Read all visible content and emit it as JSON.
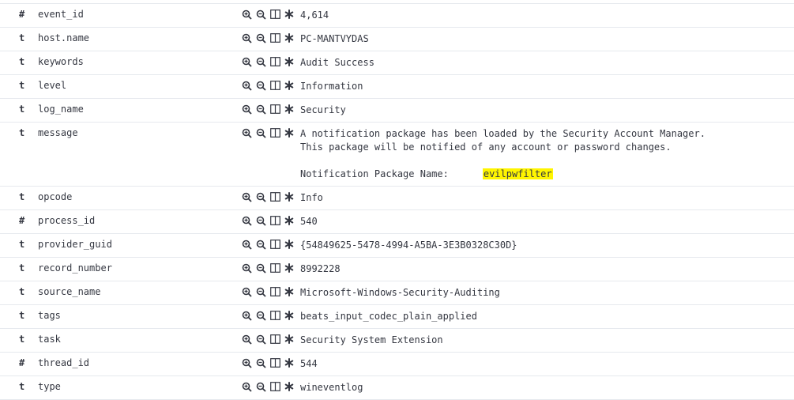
{
  "rows": [
    {
      "type": "#",
      "field": "event_id",
      "value": "4,614"
    },
    {
      "type": "t",
      "field": "host.name",
      "value": "PC-MANTVYDAS"
    },
    {
      "type": "t",
      "field": "keywords",
      "value": "Audit Success"
    },
    {
      "type": "t",
      "field": "level",
      "value": "Information"
    },
    {
      "type": "t",
      "field": "log_name",
      "value": "Security"
    },
    {
      "type": "t",
      "field": "message",
      "value_line1": "A notification package has been loaded by the Security Account Manager.",
      "value_line2": "This package will be notified of any account or password changes.",
      "value_label": "Notification Package Name:",
      "value_highlight": "evilpwfilter"
    },
    {
      "type": "t",
      "field": "opcode",
      "value": "Info"
    },
    {
      "type": "#",
      "field": "process_id",
      "value": "540"
    },
    {
      "type": "t",
      "field": "provider_guid",
      "value": "{54849625-5478-4994-A5BA-3E3B0328C30D}"
    },
    {
      "type": "t",
      "field": "record_number",
      "value": "8992228"
    },
    {
      "type": "t",
      "field": "source_name",
      "value": "Microsoft-Windows-Security-Auditing"
    },
    {
      "type": "t",
      "field": "tags",
      "value": "beats_input_codec_plain_applied"
    },
    {
      "type": "t",
      "field": "task",
      "value": "Security System Extension"
    },
    {
      "type": "#",
      "field": "thread_id",
      "value": "544"
    },
    {
      "type": "t",
      "field": "type",
      "value": "wineventlog"
    }
  ],
  "icons": {
    "filter_for": "zoom-in-icon",
    "filter_out": "zoom-out-icon",
    "toggle_column": "column-icon",
    "exists": "asterisk-icon"
  },
  "colors": {
    "highlight": "#fff500",
    "border": "#e6e9ee",
    "text": "#343741"
  }
}
